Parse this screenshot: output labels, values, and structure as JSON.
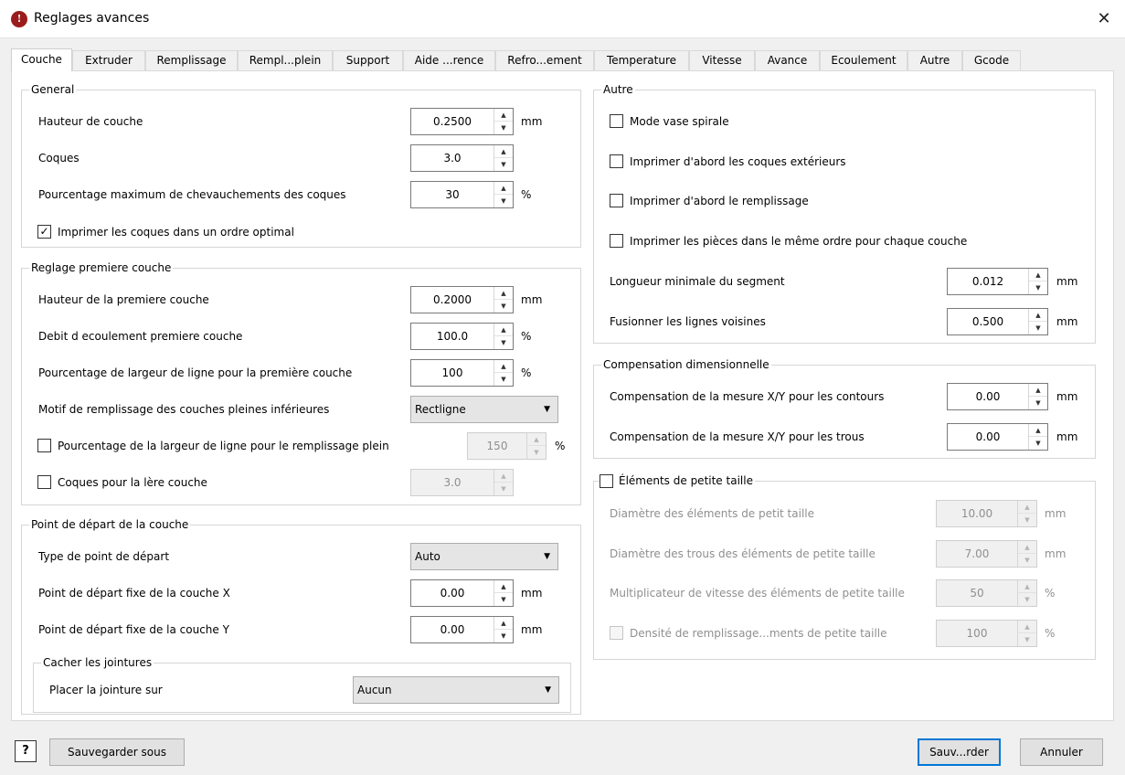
{
  "window": {
    "title": "Reglages avances"
  },
  "tabs": [
    "Couche",
    "Extruder",
    "Remplissage",
    "Rempl...plein",
    "Support",
    "Aide ...rence",
    "Refro...ement",
    "Temperature",
    "Vitesse",
    "Avance",
    "Ecoulement",
    "Autre",
    "Gcode"
  ],
  "general": {
    "title": "General",
    "layer_height_label": "Hauteur de couche",
    "layer_height": "0.2500",
    "shells_label": "Coques",
    "shells": "3.0",
    "overlap_label": "Pourcentage maximum de chevauchements des coques",
    "overlap": "30",
    "optimal_order_label": "Imprimer les coques dans un ordre optimal",
    "optimal_order_checked": true
  },
  "first_layer": {
    "title": "Reglage premiere couche",
    "height_label": "Hauteur de la premiere couche",
    "height": "0.2000",
    "flow_label": "Debit d ecoulement premiere couche",
    "flow": "100.0",
    "line_width_label": "Pourcentage de largeur de ligne pour la première couche",
    "line_width": "100",
    "bottom_pattern_label": "Motif de remplissage des couches pleines inférieures",
    "bottom_pattern": "Rectligne",
    "solid_width_label": "Pourcentage de la largeur de ligne pour le remplissage plein",
    "solid_width": "150",
    "first_shells_label": "Coques pour la lère couche",
    "first_shells": "3.0"
  },
  "start_point": {
    "title": "Point de départ de la couche",
    "type_label": "Type de point de départ",
    "type": "Auto",
    "x_label": "Point de départ fixe de la couche X",
    "x": "0.00",
    "y_label": "Point de départ fixe de la couche Y",
    "y": "0.00",
    "seam_title": "Cacher les jointures",
    "seam_label": "Placer la jointure sur",
    "seam": "Aucun"
  },
  "other": {
    "title": "Autre",
    "spiral_label": "Mode vase spirale",
    "outer_first_label": "Imprimer d'abord les coques extérieurs",
    "infill_first_label": "Imprimer d'abord le remplissage",
    "same_order_label": "Imprimer les pièces dans le même ordre pour chaque couche",
    "min_segment_label": "Longueur minimale du segment",
    "min_segment": "0.012",
    "merge_label": "Fusionner les lignes voisines",
    "merge": "0.500"
  },
  "compensation": {
    "title": "Compensation dimensionnelle",
    "contours_label": "Compensation de la mesure X/Y pour les contours",
    "contours": "0.00",
    "holes_label": "Compensation de la mesure X/Y pour les trous",
    "holes": "0.00"
  },
  "small_features": {
    "title": "Éléments de petite taille",
    "diameter_label": "Diamètre des éléments de petit taille",
    "diameter": "10.00",
    "holes_label": "Diamètre des trous des éléments de petite taille",
    "holes": "7.00",
    "speed_label": "Multiplicateur de vitesse des éléments de petite taille",
    "speed": "50",
    "density_label": "Densité de remplissage...ments de petite taille",
    "density": "100"
  },
  "units": {
    "mm": "mm",
    "pct": "%"
  },
  "footer": {
    "help": "?",
    "save_as": "Sauvegarder sous",
    "save": "Sauv...rder",
    "cancel": "Annuler"
  }
}
